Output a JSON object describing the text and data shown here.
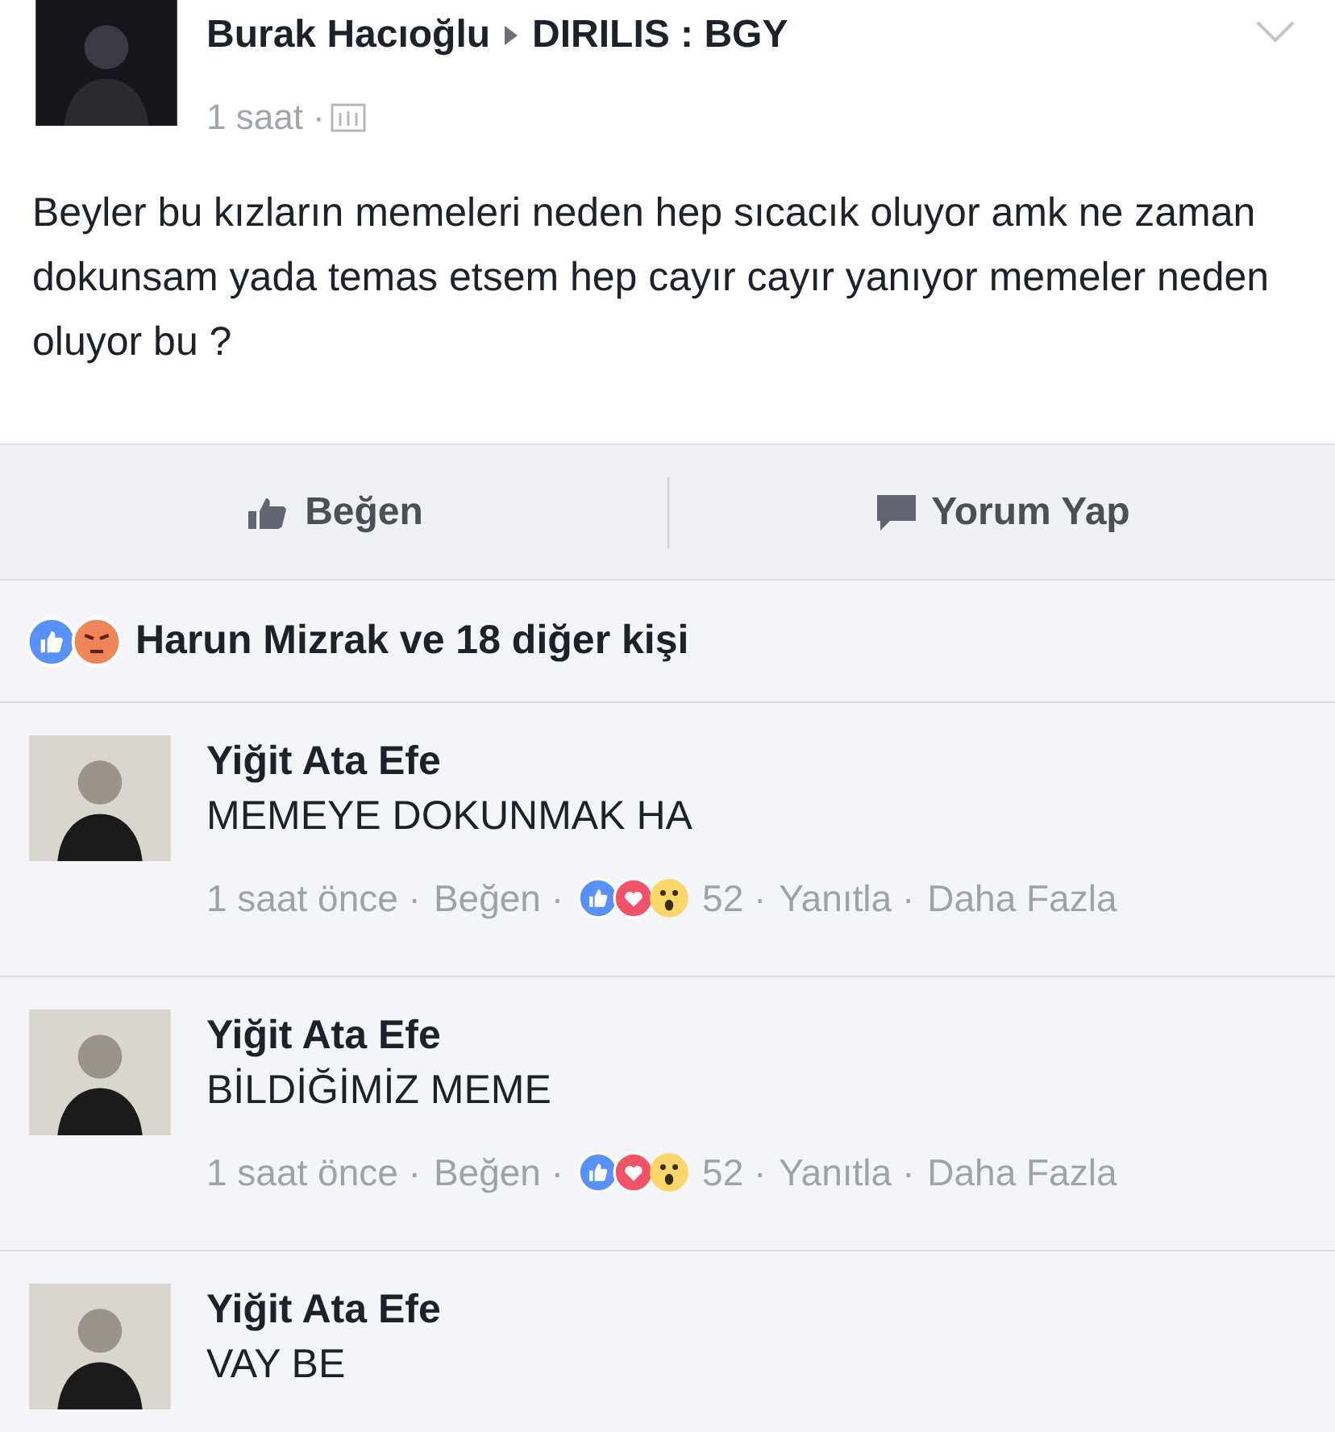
{
  "post": {
    "author": "Burak Hacıoğlu",
    "group": "DIRILIS : BGY",
    "time": "1 saat ·",
    "text": "Beyler bu kızların memeleri neden hep sıcacık oluyor amk ne zaman dokunsam yada temas etsem hep cayır cayır yanıyor memeler neden oluyor bu ?"
  },
  "actions": [
    {
      "kind": "like",
      "label": "Beğen"
    },
    {
      "kind": "comment",
      "label": "Yorum Yap"
    }
  ],
  "reactions_summary": {
    "icons": [
      {
        "kind": "like"
      },
      {
        "kind": "angry"
      }
    ],
    "text": "Harun Mizrak ve 18 diğer kişi"
  },
  "comments": [
    {
      "author": "Yiğit Ata Efe",
      "text": "MEMEYE DOKUNMAK HA",
      "meta": {
        "time": "1 saat önce ·",
        "like": "Beğen ·",
        "reactions": [
          {
            "kind": "like"
          },
          {
            "kind": "love"
          },
          {
            "kind": "wow"
          }
        ],
        "count": "52 ·",
        "reply": "Yanıtla ·",
        "more": "Daha Fazla"
      }
    },
    {
      "author": "Yiğit Ata Efe",
      "text": "BİLDİĞİMİZ MEME",
      "meta": {
        "time": "1 saat önce ·",
        "like": "Beğen ·",
        "reactions": [
          {
            "kind": "like"
          },
          {
            "kind": "love"
          },
          {
            "kind": "wow"
          }
        ],
        "count": "52 ·",
        "reply": "Yanıtla ·",
        "more": "Daha Fazla"
      }
    },
    {
      "author": "Yiğit Ata Efe",
      "text": "VAY BE"
    }
  ]
}
